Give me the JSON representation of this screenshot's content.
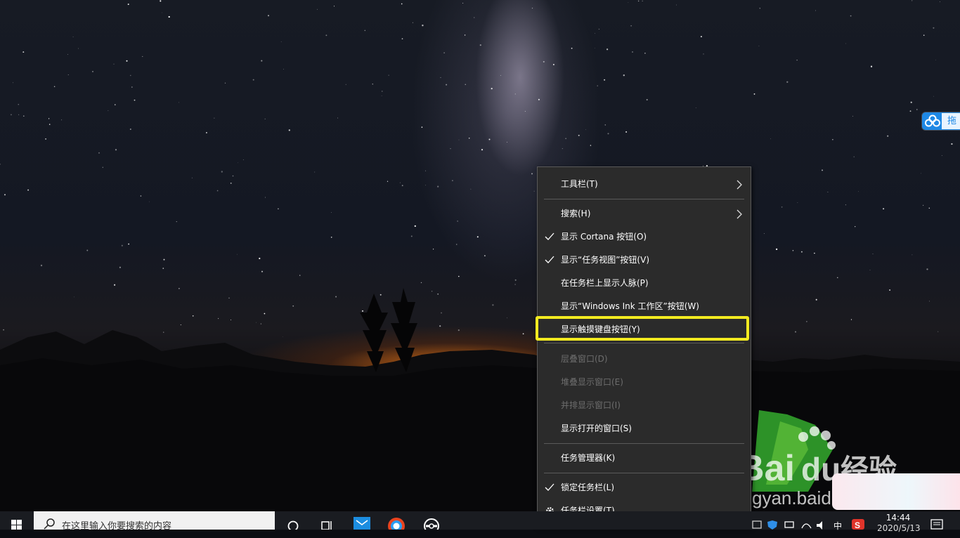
{
  "side_tab": {
    "label": "拖"
  },
  "watermark": {
    "brand": "Bai",
    "brand_cn": "经验",
    "url": "jingyan.baidu.com"
  },
  "context_menu": {
    "items": [
      {
        "label": "工具栏(T)",
        "checked": false,
        "submenu": true,
        "disabled": false
      },
      {
        "label": "搜索(H)",
        "checked": false,
        "submenu": true,
        "disabled": false
      },
      {
        "label": "显示 Cortana 按钮(O)",
        "checked": true,
        "submenu": false,
        "disabled": false
      },
      {
        "label": "显示“任务视图”按钮(V)",
        "checked": true,
        "submenu": false,
        "disabled": false
      },
      {
        "label": "在任务栏上显示人脉(P)",
        "checked": false,
        "submenu": false,
        "disabled": false
      },
      {
        "label": "显示“Windows Ink 工作区”按钮(W)",
        "checked": false,
        "submenu": false,
        "disabled": false
      },
      {
        "label": "显示触摸键盘按钮(Y)",
        "checked": false,
        "submenu": false,
        "disabled": false,
        "highlighted": true
      },
      {
        "label": "层叠窗口(D)",
        "checked": false,
        "submenu": false,
        "disabled": true
      },
      {
        "label": "堆叠显示窗口(E)",
        "checked": false,
        "submenu": false,
        "disabled": true
      },
      {
        "label": "并排显示窗口(I)",
        "checked": false,
        "submenu": false,
        "disabled": true
      },
      {
        "label": "显示打开的窗口(S)",
        "checked": false,
        "submenu": false,
        "disabled": false
      },
      {
        "label": "任务管理器(K)",
        "checked": false,
        "submenu": false,
        "disabled": false
      },
      {
        "label": "锁定任务栏(L)",
        "checked": true,
        "submenu": false,
        "disabled": false
      },
      {
        "label": "任务栏设置(T)",
        "checked": false,
        "submenu": false,
        "disabled": false,
        "icon": "gear-icon"
      }
    ],
    "highlight_color": "#f2ea20"
  },
  "taskbar": {
    "search_placeholder": "在这里输入你要搜索的内容",
    "pinned": [
      "cortana-icon",
      "task-view-icon",
      "mail-app-icon",
      "browser-icon",
      "media-app-icon"
    ],
    "tray": {
      "ime": "中",
      "time": "14:44",
      "date": "2020/5/13"
    }
  }
}
